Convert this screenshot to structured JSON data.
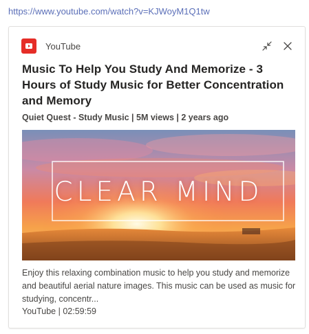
{
  "link": {
    "url": "https://www.youtube.com/watch?v=KJWoyM1Q1tw"
  },
  "card": {
    "provider": "YouTube",
    "logo_icon": "youtube-play-icon",
    "actions": {
      "collapse_icon": "collapse-arrows-icon",
      "close_icon": "close-icon"
    },
    "title": "Music To Help You Study And Memorize - 3 Hours of Study Music for Better Concentration and Memory",
    "meta": "Quiet Quest - Study Music | 5M views | 2 years ago",
    "thumbnail": {
      "overlay_text": "CLEAR MIND"
    },
    "description": "Enjoy this relaxing combination music to help you study and memorize and beautiful aerial nature images. This music can be used as music for studying, concentr...",
    "footer": "YouTube | 02:59:59"
  },
  "colors": {
    "link": "#5b6fb8",
    "brand_red": "#e52d27",
    "text": "#252423",
    "border": "#e1dfdd"
  }
}
